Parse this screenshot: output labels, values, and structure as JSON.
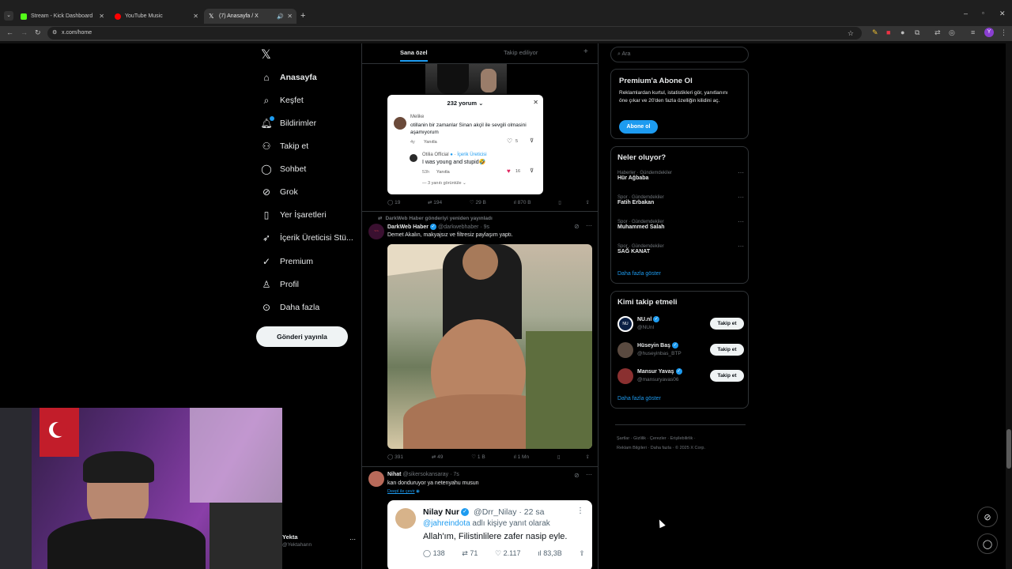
{
  "browser": {
    "tabs": [
      {
        "title": "Stream - Kick Dashboard",
        "favicon_color": "#53fc18"
      },
      {
        "title": "YouTube Music",
        "favicon_color": "#ff0000"
      },
      {
        "title": "(7) Anasayfa / X",
        "favicon_color": "#ffffff"
      }
    ],
    "url": "x.com/home",
    "new_tab": "+"
  },
  "nav": {
    "logo": "𝕏",
    "items": [
      {
        "label": "Anasayfa",
        "icon": "home-icon"
      },
      {
        "label": "Keşfet",
        "icon": "search-icon"
      },
      {
        "label": "Bildirimler",
        "icon": "bell-icon"
      },
      {
        "label": "Takip et",
        "icon": "add-user-icon"
      },
      {
        "label": "Sohbet",
        "icon": "chat-icon"
      },
      {
        "label": "Grok",
        "icon": "grok-icon"
      },
      {
        "label": "Yer İşaretleri",
        "icon": "bookmark-icon"
      },
      {
        "label": "İçerik Üreticisi Stü...",
        "icon": "rocket-icon"
      },
      {
        "label": "Premium",
        "icon": "premium-icon"
      },
      {
        "label": "Profil",
        "icon": "profile-icon"
      },
      {
        "label": "Daha fazla",
        "icon": "more-icon"
      }
    ],
    "post_button": "Gönderi yayınla",
    "account_name": "Yekta",
    "account_handle": "@Yektahann"
  },
  "timeline": {
    "tabs": [
      "Sana özel",
      "Takip ediliyor"
    ],
    "add_tab": "+",
    "popup": {
      "header": "232 yorum",
      "comment1_user": "Melike",
      "comment1_text": "otillanin bir zamanlar Sinan akçil ile sevgili olmasini aşamıyorum",
      "comment1_time": "4y",
      "comment1_reply": "Yanıtla",
      "comment1_likes": "5",
      "comment2_user": "Otilia Official",
      "comment2_badge": "İçerik Üreticisi",
      "comment2_text": "I was young and stupid🤣",
      "comment2_time": "53h",
      "comment2_reply": "Yanıtla",
      "comment2_likes": "16",
      "more_replies": "3 yanıtı görüntüle"
    },
    "post1_stats": {
      "replies": "19",
      "reposts": "194",
      "likes": "29 B",
      "views": "870 B"
    },
    "post2": {
      "repost_note": "DarkWeb Haber gönderiyi yeniden yayınladı",
      "name": "DarkWeb Haber",
      "handle": "@darkwebhaber · 9s",
      "text": "Demet Akalın, makyajsız ve filtresiz paylaşım yaptı.",
      "stats": {
        "replies": "391",
        "reposts": "49",
        "likes": "1 B",
        "views": "1 Mn"
      }
    },
    "post3": {
      "name": "Nihat",
      "handle": "@sikersokansaray · 7s",
      "text": "kan donduruyor ya netenyahu musun",
      "translate": "Deepl ile çevir",
      "quote": {
        "name": "Nilay Nur",
        "handle": "@Drr_Nilay · 22 sa",
        "reply_to": "@jahreindota",
        "reply_suffix": "adlı kişiye yanıt olarak",
        "text": "Allah'ım, Filistinlilere zafer nasip eyle.",
        "stats": {
          "replies": "138",
          "reposts": "71",
          "likes": "2.117",
          "views": "83,3B"
        }
      }
    }
  },
  "sidebar": {
    "search_placeholder": "Ara",
    "premium": {
      "title": "Premium'a Abone Ol",
      "text": "Reklamlardan kurtul, istatistikleri gör, yanıtlanını öne çıkar ve 20'den fazla özelliğin kilidini aç.",
      "button": "Abone ol"
    },
    "trends": {
      "title": "Neler oluyor?",
      "items": [
        {
          "category": "Haberler · Gündemdekiler",
          "name": "Hür Ağbaba"
        },
        {
          "category": "Spor · Gündemdekiler",
          "name": "Fatih Erbakan"
        },
        {
          "category": "Spor · Gündemdekiler",
          "name": "Muhammed Salah"
        },
        {
          "category": "Spor · Gündemdekiler",
          "name": "SAĞ KANAT"
        }
      ],
      "more": "Daha fazla göster"
    },
    "who_to_follow": {
      "title": "Kimi takip etmeli",
      "items": [
        {
          "name": "NU.nl",
          "handle": "@NUnl",
          "button": "Takip et"
        },
        {
          "name": "Hüseyin Baş",
          "handle": "@huseyinbas_BTP",
          "button": "Takip et"
        },
        {
          "name": "Mansur Yavaş",
          "handle": "@mansuryavas06",
          "button": "Takip et"
        }
      ],
      "more": "Daha fazla göster"
    },
    "footer": {
      "line1": [
        "Şartlar",
        "Gizlilik",
        "Çerezler",
        "Erişilebilirlik"
      ],
      "line2": [
        "Reklam Bilgileri",
        "Daha fazla",
        "© 2025 X Corp."
      ]
    }
  },
  "colors": {
    "accent": "#1d9bf0",
    "background": "#000000",
    "border": "#2f3336",
    "muted": "#71767b"
  }
}
